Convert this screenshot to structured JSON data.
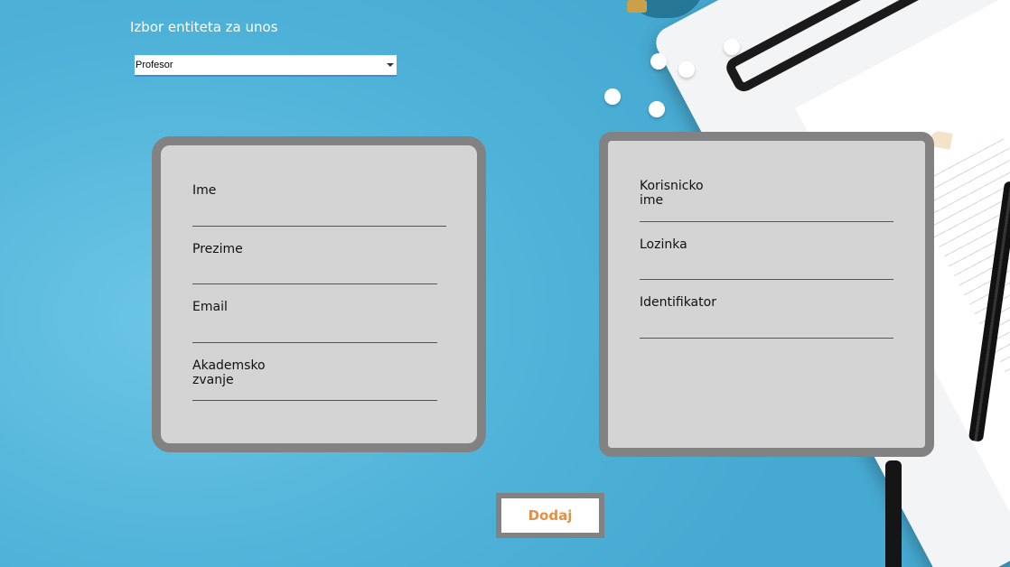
{
  "header": {
    "title": "Izbor entiteta za unos"
  },
  "entity_select": {
    "selected": "Profesor"
  },
  "left_panel": {
    "fields": [
      {
        "label": "Ime"
      },
      {
        "label": "Prezime"
      },
      {
        "label": "Email"
      },
      {
        "label": "Akademsko zvanje"
      }
    ]
  },
  "right_panel": {
    "fields": [
      {
        "label": "Korisnicko ime"
      },
      {
        "label": "Lozinka"
      },
      {
        "label": "Identifikator"
      }
    ]
  },
  "actions": {
    "add_label": "Dodaj"
  },
  "colors": {
    "background": "#5cbbdd",
    "panel_fill": "#d4d4d4",
    "panel_border": "#828282",
    "button_text": "#e58f45",
    "select_underline": "#3b8fd6"
  }
}
